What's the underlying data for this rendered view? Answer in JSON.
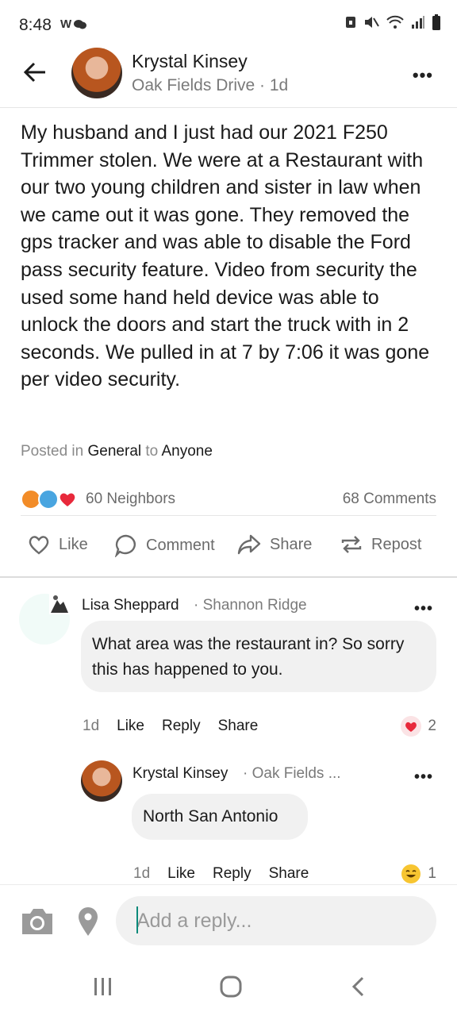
{
  "status_bar": {
    "time": "8:48",
    "notif_icons": "W"
  },
  "header": {
    "author_name": "Krystal Kinsey",
    "author_location": "Oak Fields Drive",
    "post_age": "1d"
  },
  "post": {
    "body": "My husband and I just had our 2021 F250 Trimmer stolen. We were at a Restaurant with our two young children and sister in law when we came out it was gone. They removed the gps tracker and was able to disable the Ford pass security feature. Video from security the used some hand held device was able to unlock the doors and start the truck with in 2 seconds. We pulled in at 7 by 7:06 it was gone per video security.",
    "posted_in_prefix": "Posted in",
    "category": "General",
    "to_prefix": "to",
    "audience": "Anyone"
  },
  "stats": {
    "neighbors": "60 Neighbors",
    "comments": "68 Comments"
  },
  "actions": {
    "like": "Like",
    "comment": "Comment",
    "share": "Share",
    "repost": "Repost"
  },
  "comments": [
    {
      "name": "Lisa Sheppard",
      "location": "Shannon Ridge",
      "text": "What area was the restaurant in?  So sorry this has happened to you.",
      "time": "1d",
      "like": "Like",
      "reply": "Reply",
      "share": "Share",
      "reaction_count": "2"
    },
    {
      "name": "Krystal Kinsey",
      "location": "Oak Fields ...",
      "text": "North San Antonio",
      "time": "1d",
      "like": "Like",
      "reply": "Reply",
      "share": "Share",
      "reaction_count": "1"
    }
  ],
  "reply_bar": {
    "placeholder": "Add a reply..."
  },
  "colors": {
    "heart": "#e8293b",
    "accent": "#0a8a7a"
  }
}
